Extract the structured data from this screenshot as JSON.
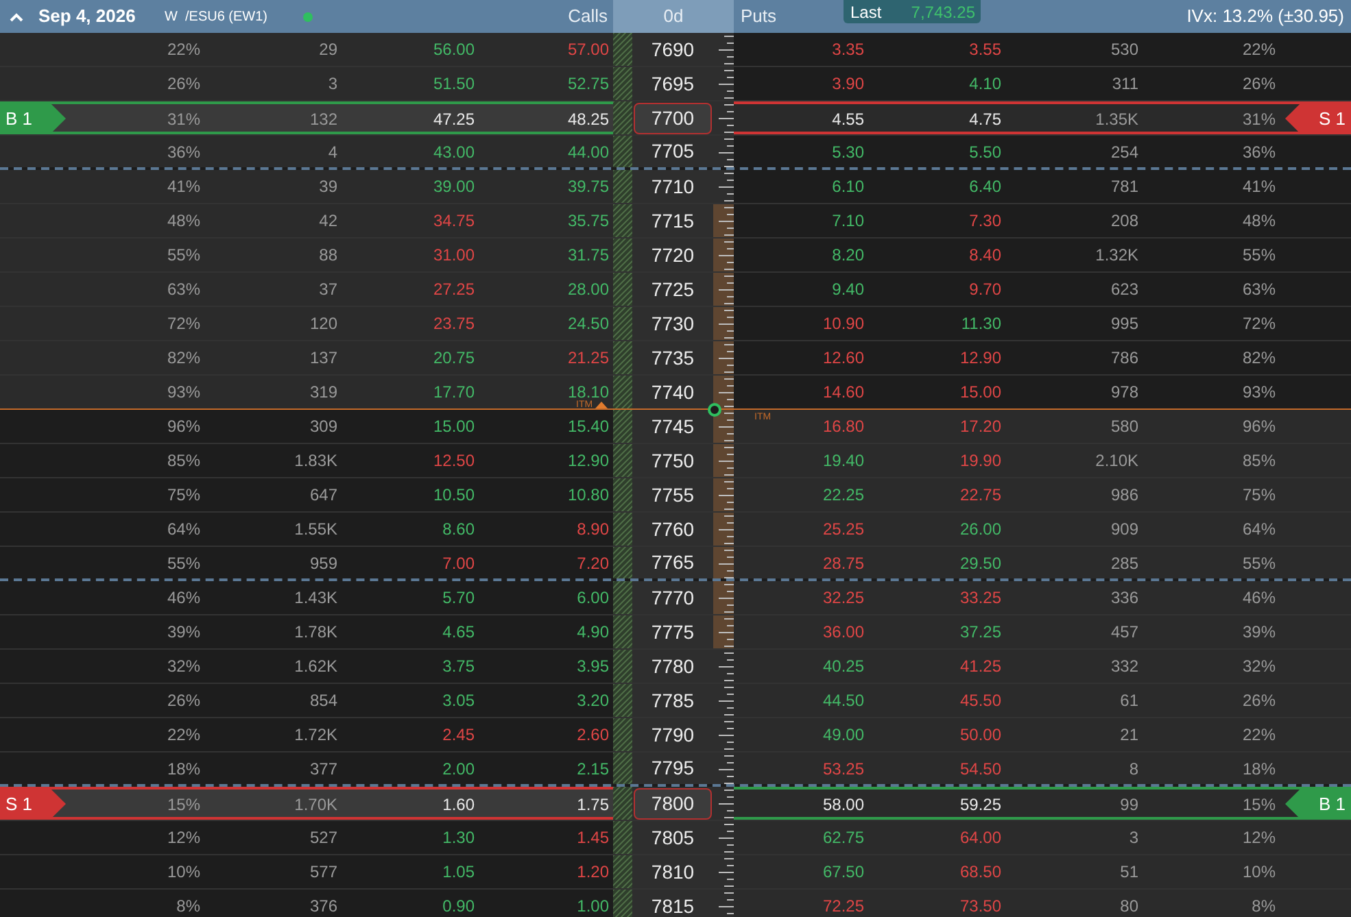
{
  "header": {
    "expanded": true,
    "date": "Sep 4, 2026",
    "symbol": "W  /ESU6 (EW1)",
    "live": true,
    "calls_label": "Calls",
    "dte": "0d",
    "puts_label": "Puts",
    "last_label": "Last",
    "last_value": "7,743.25",
    "ivx": "IVx: 13.2% (±30.95)"
  },
  "last_price": {
    "call_label": "ITM",
    "put_label": "ITM"
  },
  "rows": [
    {
      "strike": "7690",
      "call_itm": true,
      "expected_move": false,
      "dashed_below": false,
      "last_below": false,
      "call_iv": "22%",
      "call_vol": "29",
      "call_bid": {
        "value": "56.00",
        "color": "#43b967"
      },
      "call_ask": {
        "value": "57.00",
        "color": "#e04646"
      },
      "put_bid": {
        "value": "3.35",
        "color": "#e04646"
      },
      "put_ask": {
        "value": "3.55",
        "color": "#e04646"
      },
      "put_vol": "530",
      "put_iv": "22%"
    },
    {
      "strike": "7695",
      "call_itm": true,
      "expected_move": false,
      "dashed_below": false,
      "last_below": false,
      "call_iv": "26%",
      "call_vol": "3",
      "call_bid": {
        "value": "51.50",
        "color": "#43b967"
      },
      "call_ask": {
        "value": "52.75",
        "color": "#43b967"
      },
      "put_bid": {
        "value": "3.90",
        "color": "#e04646"
      },
      "put_ask": {
        "value": "4.10",
        "color": "#43b967"
      },
      "put_vol": "311",
      "put_iv": "26%"
    },
    {
      "strike": "7700",
      "expected_move": false,
      "dashed_below": false,
      "last_below": false,
      "call_iv": "31%",
      "call_vol": "132",
      "call_bid": {
        "value": "47.25",
        "color": "#e8e8e8"
      },
      "call_ask": {
        "value": "48.25",
        "color": "#e8e8e8"
      },
      "put_bid": {
        "value": "4.55",
        "color": "#e8e8e8"
      },
      "put_ask": {
        "value": "4.75",
        "color": "#e8e8e8"
      },
      "put_vol": "1.35K",
      "put_iv": "31%",
      "call_position": {
        "label": "B 1",
        "kind": "buy"
      },
      "put_position": {
        "label": "S 1",
        "kind": "sell"
      }
    },
    {
      "strike": "7705",
      "call_itm": true,
      "expected_move": false,
      "dashed_below": true,
      "last_below": false,
      "call_iv": "36%",
      "call_vol": "4",
      "call_bid": {
        "value": "43.00",
        "color": "#43b967"
      },
      "call_ask": {
        "value": "44.00",
        "color": "#43b967"
      },
      "put_bid": {
        "value": "5.30",
        "color": "#43b967"
      },
      "put_ask": {
        "value": "5.50",
        "color": "#43b967"
      },
      "put_vol": "254",
      "put_iv": "36%"
    },
    {
      "strike": "7710",
      "call_itm": true,
      "expected_move": false,
      "dashed_below": false,
      "last_below": false,
      "call_iv": "41%",
      "call_vol": "39",
      "call_bid": {
        "value": "39.00",
        "color": "#43b967"
      },
      "call_ask": {
        "value": "39.75",
        "color": "#43b967"
      },
      "put_bid": {
        "value": "6.10",
        "color": "#43b967"
      },
      "put_ask": {
        "value": "6.40",
        "color": "#43b967"
      },
      "put_vol": "781",
      "put_iv": "41%"
    },
    {
      "strike": "7715",
      "call_itm": true,
      "expected_move": true,
      "dashed_below": false,
      "last_below": false,
      "call_iv": "48%",
      "call_vol": "42",
      "call_bid": {
        "value": "34.75",
        "color": "#e04646"
      },
      "call_ask": {
        "value": "35.75",
        "color": "#43b967"
      },
      "put_bid": {
        "value": "7.10",
        "color": "#43b967"
      },
      "put_ask": {
        "value": "7.30",
        "color": "#e04646"
      },
      "put_vol": "208",
      "put_iv": "48%"
    },
    {
      "strike": "7720",
      "call_itm": true,
      "expected_move": true,
      "dashed_below": false,
      "last_below": false,
      "call_iv": "55%",
      "call_vol": "88",
      "call_bid": {
        "value": "31.00",
        "color": "#e04646"
      },
      "call_ask": {
        "value": "31.75",
        "color": "#43b967"
      },
      "put_bid": {
        "value": "8.20",
        "color": "#43b967"
      },
      "put_ask": {
        "value": "8.40",
        "color": "#e04646"
      },
      "put_vol": "1.32K",
      "put_iv": "55%"
    },
    {
      "strike": "7725",
      "call_itm": true,
      "expected_move": true,
      "dashed_below": false,
      "last_below": false,
      "call_iv": "63%",
      "call_vol": "37",
      "call_bid": {
        "value": "27.25",
        "color": "#e04646"
      },
      "call_ask": {
        "value": "28.00",
        "color": "#43b967"
      },
      "put_bid": {
        "value": "9.40",
        "color": "#43b967"
      },
      "put_ask": {
        "value": "9.70",
        "color": "#e04646"
      },
      "put_vol": "623",
      "put_iv": "63%"
    },
    {
      "strike": "7730",
      "call_itm": true,
      "expected_move": true,
      "dashed_below": false,
      "last_below": false,
      "call_iv": "72%",
      "call_vol": "120",
      "call_bid": {
        "value": "23.75",
        "color": "#e04646"
      },
      "call_ask": {
        "value": "24.50",
        "color": "#43b967"
      },
      "put_bid": {
        "value": "10.90",
        "color": "#e04646"
      },
      "put_ask": {
        "value": "11.30",
        "color": "#43b967"
      },
      "put_vol": "995",
      "put_iv": "72%"
    },
    {
      "strike": "7735",
      "call_itm": true,
      "expected_move": true,
      "dashed_below": false,
      "last_below": false,
      "call_iv": "82%",
      "call_vol": "137",
      "call_bid": {
        "value": "20.75",
        "color": "#43b967"
      },
      "call_ask": {
        "value": "21.25",
        "color": "#e04646"
      },
      "put_bid": {
        "value": "12.60",
        "color": "#e04646"
      },
      "put_ask": {
        "value": "12.90",
        "color": "#e04646"
      },
      "put_vol": "786",
      "put_iv": "82%"
    },
    {
      "strike": "7740",
      "call_itm": true,
      "expected_move": true,
      "dashed_below": false,
      "last_below": true,
      "call_iv": "93%",
      "call_vol": "319",
      "call_bid": {
        "value": "17.70",
        "color": "#43b967"
      },
      "call_ask": {
        "value": "18.10",
        "color": "#43b967"
      },
      "put_bid": {
        "value": "14.60",
        "color": "#e04646"
      },
      "put_ask": {
        "value": "15.00",
        "color": "#e04646"
      },
      "put_vol": "978",
      "put_iv": "93%"
    },
    {
      "strike": "7745",
      "call_itm": false,
      "expected_move": true,
      "dashed_below": false,
      "last_below": false,
      "call_iv": "96%",
      "call_vol": "309",
      "call_bid": {
        "value": "15.00",
        "color": "#43b967"
      },
      "call_ask": {
        "value": "15.40",
        "color": "#43b967"
      },
      "put_bid": {
        "value": "16.80",
        "color": "#e04646"
      },
      "put_ask": {
        "value": "17.20",
        "color": "#e04646"
      },
      "put_vol": "580",
      "put_iv": "96%"
    },
    {
      "strike": "7750",
      "call_itm": false,
      "expected_move": true,
      "dashed_below": false,
      "last_below": false,
      "call_iv": "85%",
      "call_vol": "1.83K",
      "call_bid": {
        "value": "12.50",
        "color": "#e04646"
      },
      "call_ask": {
        "value": "12.90",
        "color": "#43b967"
      },
      "put_bid": {
        "value": "19.40",
        "color": "#43b967"
      },
      "put_ask": {
        "value": "19.90",
        "color": "#e04646"
      },
      "put_vol": "2.10K",
      "put_iv": "85%"
    },
    {
      "strike": "7755",
      "call_itm": false,
      "expected_move": true,
      "dashed_below": false,
      "last_below": false,
      "call_iv": "75%",
      "call_vol": "647",
      "call_bid": {
        "value": "10.50",
        "color": "#43b967"
      },
      "call_ask": {
        "value": "10.80",
        "color": "#43b967"
      },
      "put_bid": {
        "value": "22.25",
        "color": "#43b967"
      },
      "put_ask": {
        "value": "22.75",
        "color": "#e04646"
      },
      "put_vol": "986",
      "put_iv": "75%"
    },
    {
      "strike": "7760",
      "call_itm": false,
      "expected_move": true,
      "dashed_below": false,
      "last_below": false,
      "call_iv": "64%",
      "call_vol": "1.55K",
      "call_bid": {
        "value": "8.60",
        "color": "#43b967"
      },
      "call_ask": {
        "value": "8.90",
        "color": "#e04646"
      },
      "put_bid": {
        "value": "25.25",
        "color": "#e04646"
      },
      "put_ask": {
        "value": "26.00",
        "color": "#43b967"
      },
      "put_vol": "909",
      "put_iv": "64%"
    },
    {
      "strike": "7765",
      "call_itm": false,
      "expected_move": true,
      "dashed_below": true,
      "last_below": false,
      "call_iv": "55%",
      "call_vol": "959",
      "call_bid": {
        "value": "7.00",
        "color": "#e04646"
      },
      "call_ask": {
        "value": "7.20",
        "color": "#e04646"
      },
      "put_bid": {
        "value": "28.75",
        "color": "#e04646"
      },
      "put_ask": {
        "value": "29.50",
        "color": "#43b967"
      },
      "put_vol": "285",
      "put_iv": "55%"
    },
    {
      "strike": "7770",
      "call_itm": false,
      "expected_move": true,
      "dashed_below": false,
      "last_below": false,
      "call_iv": "46%",
      "call_vol": "1.43K",
      "call_bid": {
        "value": "5.70",
        "color": "#43b967"
      },
      "call_ask": {
        "value": "6.00",
        "color": "#43b967"
      },
      "put_bid": {
        "value": "32.25",
        "color": "#e04646"
      },
      "put_ask": {
        "value": "33.25",
        "color": "#e04646"
      },
      "put_vol": "336",
      "put_iv": "46%"
    },
    {
      "strike": "7775",
      "call_itm": false,
      "expected_move": true,
      "dashed_below": false,
      "last_below": false,
      "call_iv": "39%",
      "call_vol": "1.78K",
      "call_bid": {
        "value": "4.65",
        "color": "#43b967"
      },
      "call_ask": {
        "value": "4.90",
        "color": "#43b967"
      },
      "put_bid": {
        "value": "36.00",
        "color": "#e04646"
      },
      "put_ask": {
        "value": "37.25",
        "color": "#43b967"
      },
      "put_vol": "457",
      "put_iv": "39%"
    },
    {
      "strike": "7780",
      "call_itm": false,
      "expected_move": false,
      "dashed_below": false,
      "last_below": false,
      "call_iv": "32%",
      "call_vol": "1.62K",
      "call_bid": {
        "value": "3.75",
        "color": "#43b967"
      },
      "call_ask": {
        "value": "3.95",
        "color": "#43b967"
      },
      "put_bid": {
        "value": "40.25",
        "color": "#43b967"
      },
      "put_ask": {
        "value": "41.25",
        "color": "#e04646"
      },
      "put_vol": "332",
      "put_iv": "32%"
    },
    {
      "strike": "7785",
      "call_itm": false,
      "expected_move": false,
      "dashed_below": false,
      "last_below": false,
      "call_iv": "26%",
      "call_vol": "854",
      "call_bid": {
        "value": "3.05",
        "color": "#43b967"
      },
      "call_ask": {
        "value": "3.20",
        "color": "#43b967"
      },
      "put_bid": {
        "value": "44.50",
        "color": "#43b967"
      },
      "put_ask": {
        "value": "45.50",
        "color": "#e04646"
      },
      "put_vol": "61",
      "put_iv": "26%"
    },
    {
      "strike": "7790",
      "call_itm": false,
      "expected_move": false,
      "dashed_below": false,
      "last_below": false,
      "call_iv": "22%",
      "call_vol": "1.72K",
      "call_bid": {
        "value": "2.45",
        "color": "#e04646"
      },
      "call_ask": {
        "value": "2.60",
        "color": "#e04646"
      },
      "put_bid": {
        "value": "49.00",
        "color": "#43b967"
      },
      "put_ask": {
        "value": "50.00",
        "color": "#e04646"
      },
      "put_vol": "21",
      "put_iv": "22%"
    },
    {
      "strike": "7795",
      "call_itm": false,
      "expected_move": false,
      "dashed_below": true,
      "last_below": false,
      "call_iv": "18%",
      "call_vol": "377",
      "call_bid": {
        "value": "2.00",
        "color": "#43b967"
      },
      "call_ask": {
        "value": "2.15",
        "color": "#43b967"
      },
      "put_bid": {
        "value": "53.25",
        "color": "#e04646"
      },
      "put_ask": {
        "value": "54.50",
        "color": "#e04646"
      },
      "put_vol": "8",
      "put_iv": "18%"
    },
    {
      "strike": "7800",
      "expected_move": false,
      "dashed_below": false,
      "last_below": false,
      "call_iv": "15%",
      "call_vol": "1.70K",
      "call_bid": {
        "value": "1.60",
        "color": "#e8e8e8"
      },
      "call_ask": {
        "value": "1.75",
        "color": "#e8e8e8"
      },
      "put_bid": {
        "value": "58.00",
        "color": "#e8e8e8"
      },
      "put_ask": {
        "value": "59.25",
        "color": "#e8e8e8"
      },
      "put_vol": "99",
      "put_iv": "15%",
      "call_position": {
        "label": "S 1",
        "kind": "sell"
      },
      "put_position": {
        "label": "B 1",
        "kind": "buy"
      }
    },
    {
      "strike": "7805",
      "call_itm": false,
      "expected_move": false,
      "dashed_below": false,
      "last_below": false,
      "call_iv": "12%",
      "call_vol": "527",
      "call_bid": {
        "value": "1.30",
        "color": "#43b967"
      },
      "call_ask": {
        "value": "1.45",
        "color": "#e04646"
      },
      "put_bid": {
        "value": "62.75",
        "color": "#43b967"
      },
      "put_ask": {
        "value": "64.00",
        "color": "#e04646"
      },
      "put_vol": "3",
      "put_iv": "12%"
    },
    {
      "strike": "7810",
      "call_itm": false,
      "expected_move": false,
      "dashed_below": false,
      "last_below": false,
      "call_iv": "10%",
      "call_vol": "577",
      "call_bid": {
        "value": "1.05",
        "color": "#43b967"
      },
      "call_ask": {
        "value": "1.20",
        "color": "#e04646"
      },
      "put_bid": {
        "value": "67.50",
        "color": "#43b967"
      },
      "put_ask": {
        "value": "68.50",
        "color": "#e04646"
      },
      "put_vol": "51",
      "put_iv": "10%"
    },
    {
      "strike": "7815",
      "call_itm": false,
      "expected_move": false,
      "dashed_below": false,
      "last_below": false,
      "call_iv": "8%",
      "call_vol": "376",
      "call_bid": {
        "value": "0.90",
        "color": "#43b967"
      },
      "call_ask": {
        "value": "1.00",
        "color": "#43b967"
      },
      "put_bid": {
        "value": "72.25",
        "color": "#e04646"
      },
      "put_ask": {
        "value": "73.50",
        "color": "#e04646"
      },
      "put_vol": "80",
      "put_iv": "8%"
    }
  ]
}
